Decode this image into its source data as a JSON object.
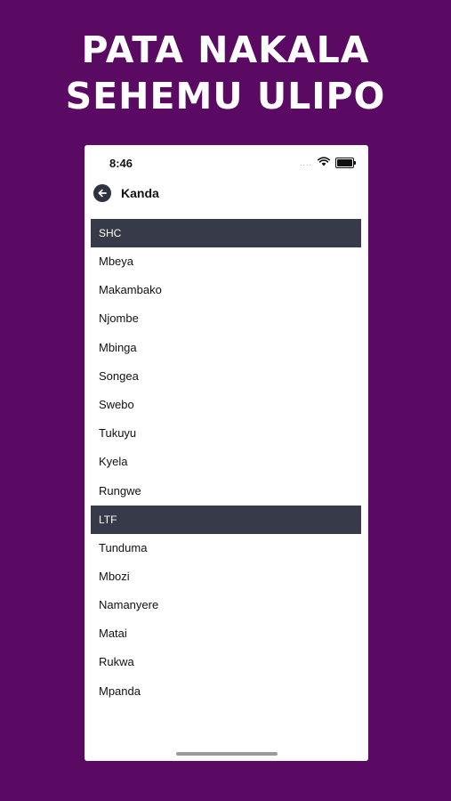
{
  "promo": {
    "line1": "PATA NAKALA",
    "line2": "SEHEMU ULIPO"
  },
  "status_bar": {
    "time": "8:46",
    "signal": "....",
    "wifi_icon": "wifi-icon",
    "battery_icon": "battery-icon"
  },
  "nav": {
    "back_icon": "back-arrow-icon",
    "title": "Kanda"
  },
  "sections": [
    {
      "header": "SHC",
      "items": [
        "Mbeya",
        "Makambako",
        "Njombe",
        "Mbinga",
        "Songea",
        "Swebo",
        "Tukuyu",
        "Kyela",
        "Rungwe"
      ]
    },
    {
      "header": "LTF",
      "items": [
        "Tunduma",
        "Mbozi",
        "Namanyere",
        "Matai",
        "Rukwa",
        "Mpanda"
      ]
    }
  ],
  "colors": {
    "background": "#5a0a62",
    "section_header": "#373a49",
    "promo_text": "#ffffff"
  }
}
